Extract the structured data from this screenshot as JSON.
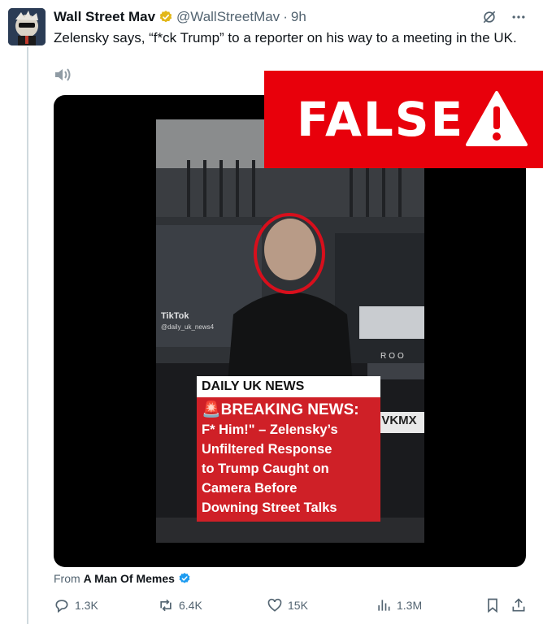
{
  "tweet": {
    "author_name": "Wall Street Mav",
    "handle": "@WallStreetMav",
    "separator": "·",
    "time": "9h",
    "text": "Zelensky says, “f*ck Trump” to a reporter on his way to a meeting in the UK."
  },
  "media": {
    "false_label": "FALSE",
    "video_overlay": {
      "tiktok_brand": "TikTok",
      "tiktok_user": "@daily_uk_news4",
      "banner_label": "DAILY UK NEWS",
      "headline_lines": [
        "🚨BREAKING NEWS:",
        "F* Him!\" – Zelensky’s",
        "Unfiltered Response",
        "to Trump Caught on",
        "Camera Before",
        "Downing Street Talks"
      ],
      "plate_text": "VKMX",
      "car_badge": "ROO"
    }
  },
  "attribution": {
    "prefix": "From",
    "source": "A Man Of Memes"
  },
  "actions": {
    "replies": "1.3K",
    "reposts": "6.4K",
    "likes": "15K",
    "views": "1.3M"
  },
  "icons": [
    "verified-badge-icon",
    "grok-icon",
    "more-icon",
    "speaker-icon",
    "warning-icon",
    "reply-icon",
    "repost-icon",
    "like-icon",
    "views-icon",
    "bookmark-icon",
    "share-icon"
  ],
  "colors": {
    "false_banner": "#e8000b",
    "verified_gold": "#e2b719",
    "verified_blue": "#1d9bf0",
    "muted_text": "#536471",
    "headline_red": "#cf2027"
  }
}
